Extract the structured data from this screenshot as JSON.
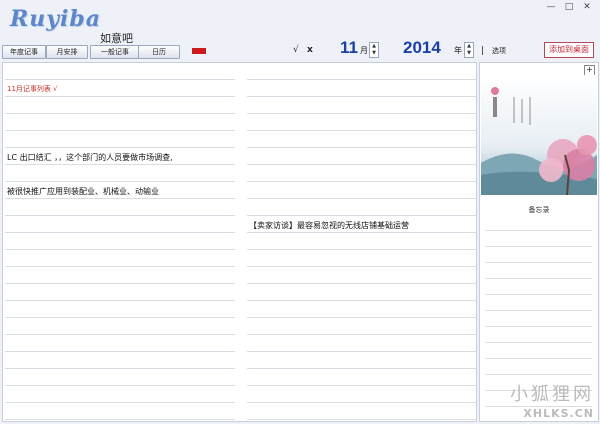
{
  "app": {
    "logo": "Ruyiba",
    "name": "如意吧"
  },
  "window_controls": [
    "—",
    "□",
    "✕"
  ],
  "toolbar": {
    "yearly": "年度记事",
    "monthly_plan": "月安排",
    "general": "一般记事",
    "calendar": "日历",
    "check": "√",
    "cross": "x",
    "month_value": "11",
    "month_unit": "月",
    "year_value": "2014",
    "year_unit": "年",
    "options": "选项",
    "add_to_desktop": "添加到桌面"
  },
  "left_entries": [
    {
      "text": "11月记事列表 √",
      "row": 1,
      "style": "red"
    },
    {
      "text": "LC 出口结汇 ，，这个部门的人员要做市场调查,",
      "row": 5,
      "style": "normal"
    },
    {
      "text": "被很快推广应用到装配业、机械业、动输业",
      "row": 7,
      "style": "normal"
    }
  ],
  "right_entries": [
    {
      "text": "【卖家访谈】最容易忽视的无线店铺基础运营",
      "row": 9,
      "style": "normal"
    }
  ],
  "sidebar": {
    "add_icon": "+",
    "memo_title": "备忘录"
  },
  "watermark": {
    "name": "小狐狸网",
    "domain": "XHLKS.CN"
  },
  "colors": {
    "accent": "#1a3fa6",
    "red": "#cc1a1a",
    "logo": "#5d87c9"
  }
}
